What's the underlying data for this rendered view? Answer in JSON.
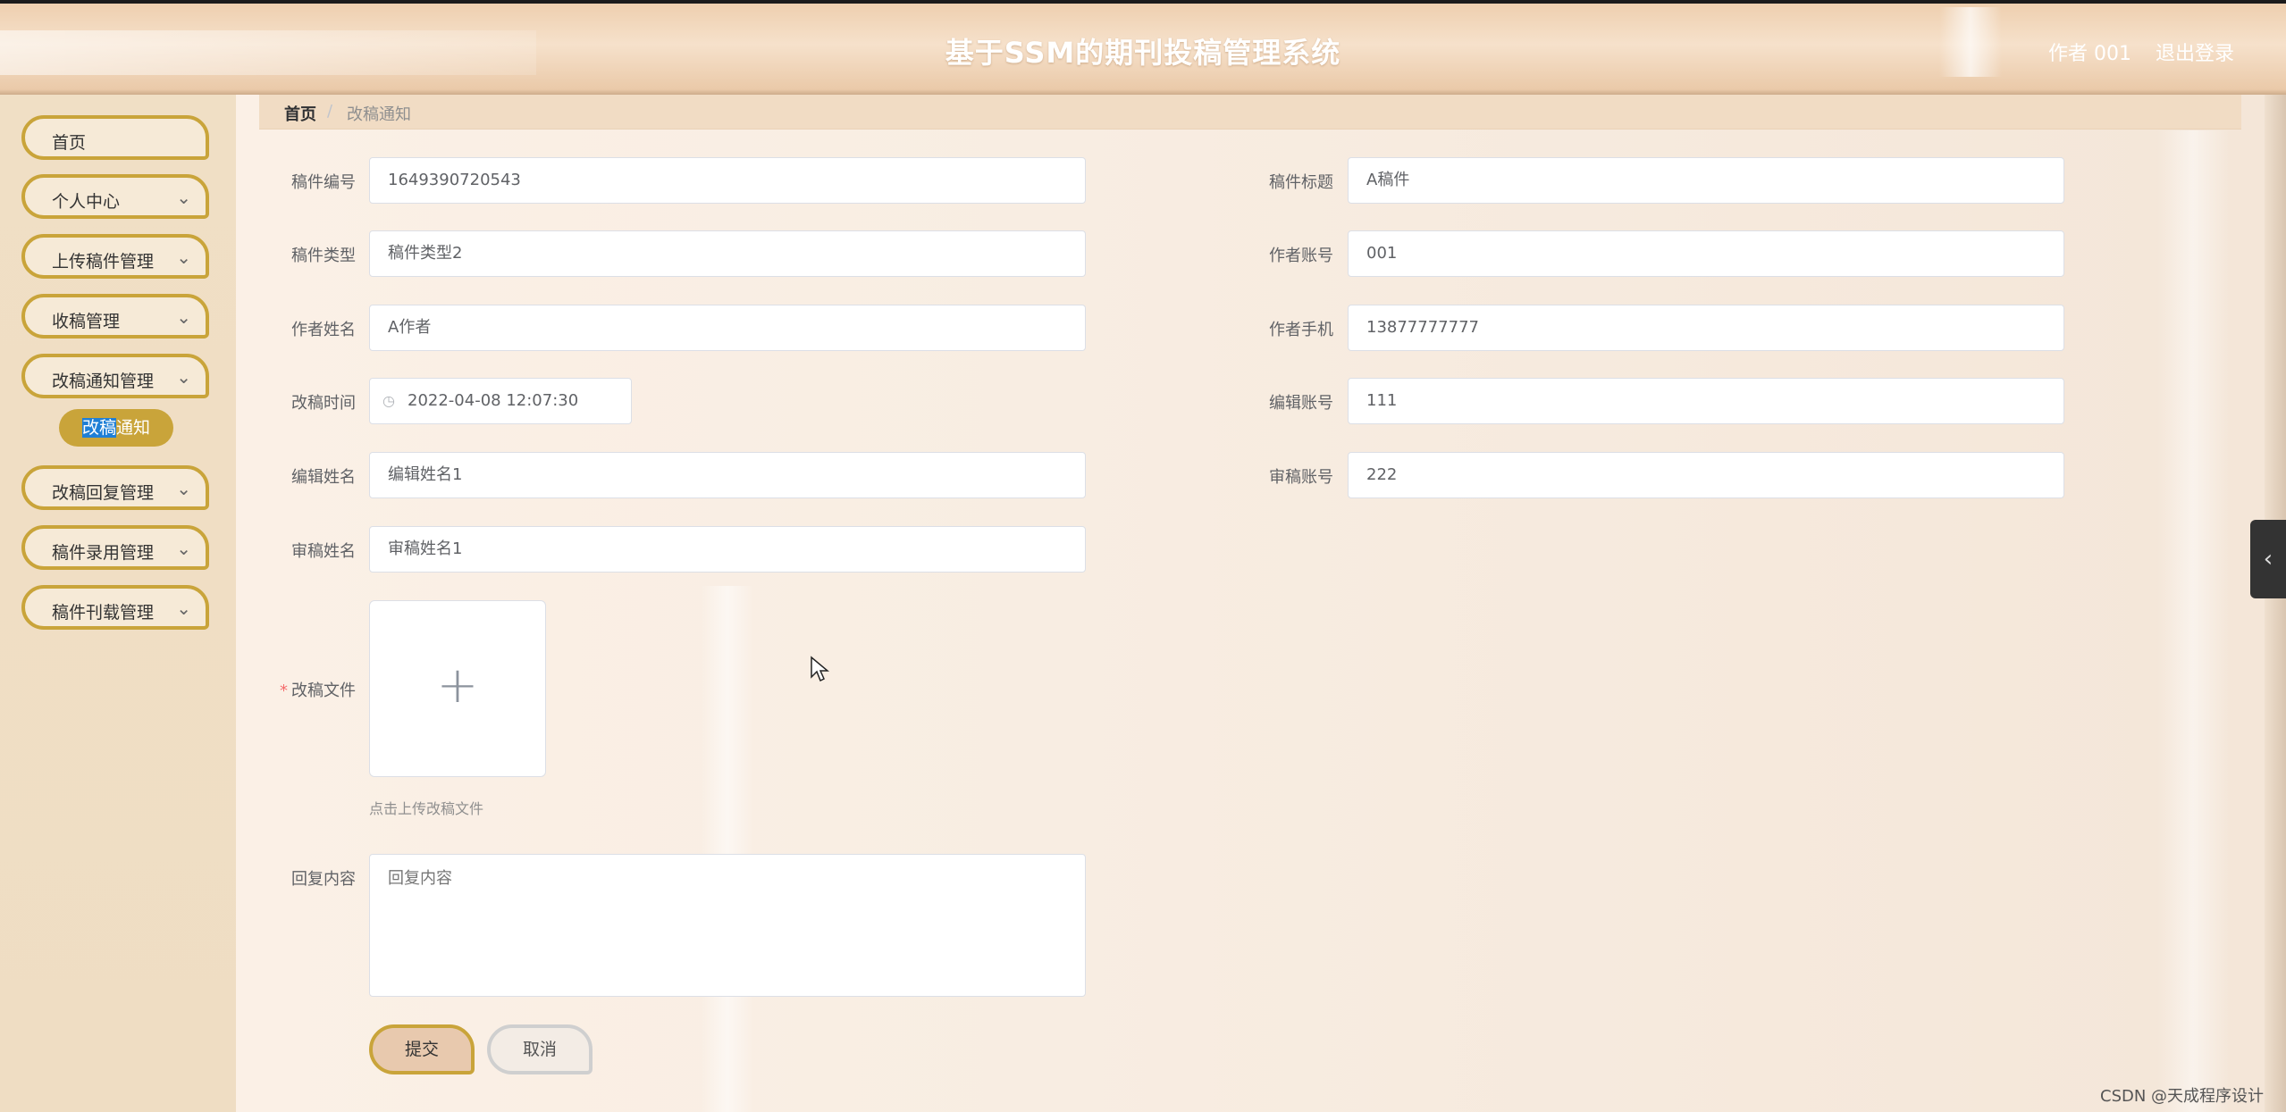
{
  "header": {
    "title": "基于SSM的期刊投稿管理系统",
    "user": "作者 001",
    "logout": "退出登录"
  },
  "sidebar": {
    "items": [
      {
        "label": "首页"
      },
      {
        "label": "个人中心"
      },
      {
        "label": "上传稿件管理"
      },
      {
        "label": "收稿管理"
      },
      {
        "label": "改稿通知管理"
      },
      {
        "label": "改稿回复管理"
      },
      {
        "label": "稿件录用管理"
      },
      {
        "label": "稿件刊载管理"
      }
    ],
    "active_sub": {
      "label_hl": "改稿",
      "label_rest": "通知"
    }
  },
  "breadcrumb": {
    "home": "首页",
    "sep": "/",
    "current": "改稿通知"
  },
  "form": {
    "manuscript_no": {
      "label": "稿件编号",
      "value": "1649390720543"
    },
    "manuscript_title": {
      "label": "稿件标题",
      "value": "A稿件"
    },
    "manuscript_type": {
      "label": "稿件类型",
      "value": "稿件类型2"
    },
    "author_account": {
      "label": "作者账号",
      "value": "001"
    },
    "author_name": {
      "label": "作者姓名",
      "value": "A作者"
    },
    "author_phone": {
      "label": "作者手机",
      "value": "13877777777"
    },
    "revise_time": {
      "label": "改稿时间",
      "value": "2022-04-08 12:07:30"
    },
    "editor_account": {
      "label": "编辑账号",
      "value": "111"
    },
    "editor_name": {
      "label": "编辑姓名",
      "value": "编辑姓名1"
    },
    "reviewer_account": {
      "label": "审稿账号",
      "value": "222"
    },
    "reviewer_name": {
      "label": "审稿姓名",
      "value": "审稿姓名1"
    },
    "revise_file": {
      "label": "改稿文件",
      "required_mark": "*",
      "tip": "点击上传改稿文件"
    },
    "reply": {
      "label": "回复内容",
      "placeholder": "回复内容"
    },
    "submit": "提交",
    "cancel": "取消"
  },
  "watermark": "CSDN @天成程序设计"
}
